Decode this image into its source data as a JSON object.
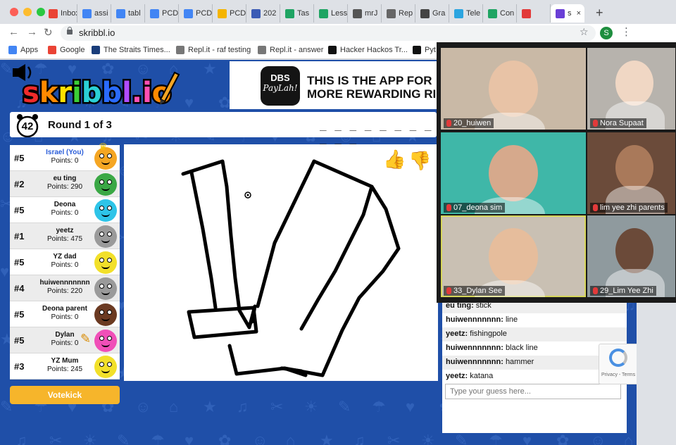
{
  "browser": {
    "tabs": [
      {
        "icon": "gmail-icon",
        "label": "Inbox",
        "color": "#ea4335"
      },
      {
        "icon": "docs-icon",
        "label": "assi",
        "color": "#4285f4"
      },
      {
        "icon": "docs-icon",
        "label": "tabl",
        "color": "#4285f4"
      },
      {
        "icon": "docs-icon",
        "label": "PCD",
        "color": "#4285f4"
      },
      {
        "icon": "docs-icon",
        "label": "PCD",
        "color": "#4285f4"
      },
      {
        "icon": "slides-icon",
        "label": "PCD",
        "color": "#f4b400"
      },
      {
        "icon": "calendar-icon",
        "label": "202",
        "color": "#3b5bb5"
      },
      {
        "icon": "drive-icon",
        "label": "Tas",
        "color": "#1fa463"
      },
      {
        "icon": "drive-icon",
        "label": "Less",
        "color": "#1fa463"
      },
      {
        "icon": "cursor-icon",
        "label": "mrJ",
        "color": "#555555"
      },
      {
        "icon": "replit-icon",
        "label": "Rep",
        "color": "#666666"
      },
      {
        "icon": "graph-icon",
        "label": "Gra",
        "color": "#444444"
      },
      {
        "icon": "telegram-icon",
        "label": "Tele",
        "color": "#2ca5e0"
      },
      {
        "icon": "drive-icon",
        "label": "Con",
        "color": "#1fa463"
      },
      {
        "icon": "recording-icon",
        "label": "",
        "color": "#e23a3a"
      },
      {
        "icon": "skribbl-icon",
        "label": "s",
        "color": "#6a3fd6",
        "active": true
      }
    ],
    "new_tab": "+",
    "url": "skribbl.io",
    "profile_letter": "S",
    "bookmarks": [
      {
        "icon": "apps-grid-icon",
        "label": "Apps",
        "color": "#4285f4"
      },
      {
        "icon": "google-icon",
        "label": "Google",
        "color": "#ea4335"
      },
      {
        "icon": "straits-times-icon",
        "label": "The Straits Times...",
        "color": "#1a3d7a"
      },
      {
        "icon": "replit-icon",
        "label": "Repl.it - raf testing",
        "color": "#777777"
      },
      {
        "icon": "replit-icon",
        "label": "Repl.it - answer",
        "color": "#777777"
      },
      {
        "icon": "hackerrank-icon",
        "label": "Hacker Hackos Tr...",
        "color": "#111111"
      },
      {
        "icon": "github-icon",
        "label": "Pyt",
        "color": "#111111"
      }
    ]
  },
  "game": {
    "logo": "skribbl.io",
    "ad": {
      "brand_top": "DBS",
      "brand_bottom": "PayLah!",
      "line1": "THIS IS THE APP FOR",
      "line2": "MORE REWARDING RID"
    },
    "timer": "42",
    "round": "Round 1 of 3",
    "word_hint": "_ _ _ _ _ _ _ _ _ _ _",
    "players": [
      {
        "rank": "#5",
        "name": "Israel (You)",
        "points": "Points: 0",
        "avatar_color": "#f5a623",
        "is_you": true,
        "crown": true
      },
      {
        "rank": "#2",
        "name": "eu ting",
        "points": "Points: 290",
        "avatar_color": "#3aa845"
      },
      {
        "rank": "#5",
        "name": "Deona",
        "points": "Points: 0",
        "avatar_color": "#2ec4e8"
      },
      {
        "rank": "#1",
        "name": "yeetz",
        "points": "Points: 475",
        "avatar_color": "#9a9a9a"
      },
      {
        "rank": "#5",
        "name": "YZ dad",
        "points": "Points: 0",
        "avatar_color": "#f2e02a"
      },
      {
        "rank": "#4",
        "name": "huiwennnnnnn",
        "points": "Points: 220",
        "avatar_color": "#9a9a9a"
      },
      {
        "rank": "#5",
        "name": "Deona parent",
        "points": "Points: 0",
        "avatar_color": "#6b3a22"
      },
      {
        "rank": "#5",
        "name": "Dylan",
        "points": "Points: 0",
        "avatar_color": "#f04fb8",
        "drawing": true
      },
      {
        "rank": "#3",
        "name": "YZ Mum",
        "points": "Points: 245",
        "avatar_color": "#f2e02a"
      }
    ],
    "votekick": "Votekick",
    "chat": [
      {
        "user": "eu ting",
        "text": "stick"
      },
      {
        "user": "huiwennnnnnn",
        "text": "line"
      },
      {
        "user": "yeetz",
        "text": "fishingpole"
      },
      {
        "user": "huiwennnnnnn",
        "text": "black line"
      },
      {
        "user": "huiwennnnnnn",
        "text": "hammer"
      },
      {
        "user": "yeetz",
        "text": "katana"
      }
    ],
    "guess_placeholder": "Type your guess here...",
    "recaptcha": "Privacy - Terms"
  },
  "zoom": {
    "participants": [
      {
        "name": "20_huiwen",
        "bg": "#c9b9a6",
        "face": "#e8c3a6"
      },
      {
        "name": "Nora Supaat",
        "bg": "#b7b3ad",
        "face": "#f0d7c4"
      },
      {
        "name": "07_deona sim",
        "bg": "#3fb7a8",
        "face": "#d6a98c"
      },
      {
        "name": "lim yee zhi parents",
        "bg": "#6b4b3a",
        "face": "#a9795a"
      },
      {
        "name": "33_Dylan See",
        "bg": "#c9c0b3",
        "face": "#e6bd9c",
        "speaking": true
      },
      {
        "name": "29_Lim Yee Zhi",
        "bg": "#8f9a9e",
        "face": "#6b4a39"
      }
    ]
  },
  "colors": {
    "page_bg": "#1f4fa8",
    "votekick": "#f6b52b",
    "you": "#2a5dd9"
  }
}
